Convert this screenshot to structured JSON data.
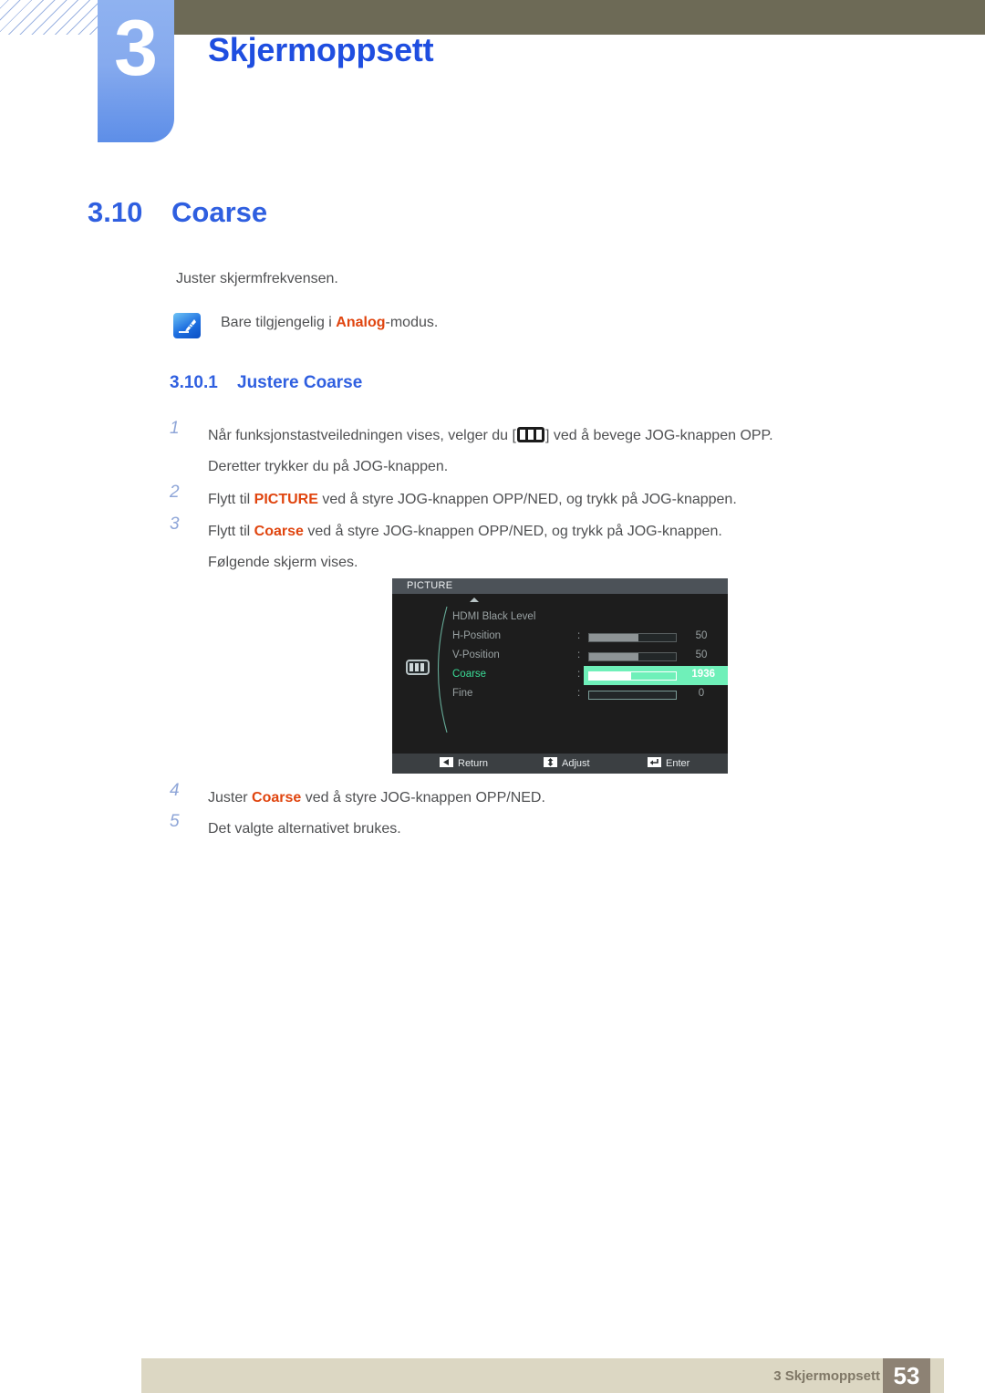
{
  "chapter": {
    "number": "3",
    "title": "Skjermoppsett"
  },
  "section": {
    "number": "3.10",
    "title": "Coarse"
  },
  "intro": "Juster skjermfrekvensen.",
  "note": {
    "icon": "note-pen-icon",
    "prefix": "Bare tilgjengelig i ",
    "highlight": "Analog",
    "suffix": "-modus."
  },
  "subsection": {
    "number": "3.10.1",
    "title": "Justere Coarse"
  },
  "steps": [
    {
      "index": "1",
      "pre": "Når funksjonstastveiledningen vises, velger du [",
      "glyph": "picture-menu-icon",
      "post": "] ved å bevege JOG-knappen OPP.",
      "cont": "Deretter trykker du på JOG-knappen."
    },
    {
      "index": "2",
      "pre": "Flytt til ",
      "highlight": "PICTURE",
      "post": " ved å styre JOG-knappen OPP/NED, og trykk på JOG-knappen."
    },
    {
      "index": "3",
      "pre": "Flytt til ",
      "highlight": "Coarse",
      "post": " ved å styre JOG-knappen OPP/NED, og trykk på JOG-knappen.",
      "cont": "Følgende skjerm vises."
    },
    {
      "index": "4",
      "pre": "Juster ",
      "highlight": "Coarse",
      "post": " ved å styre JOG-knappen OPP/NED."
    },
    {
      "index": "5",
      "pre": "Det valgte alternativet brukes."
    }
  ],
  "osd": {
    "title": "PICTURE",
    "category_icon": "picture-category-icon",
    "scroll_up_icon": "scroll-up-arrow-icon",
    "rows": [
      {
        "label": "HDMI Black Level",
        "colon": "",
        "value": "",
        "fill_pct": null,
        "selected": false
      },
      {
        "label": "H-Position",
        "colon": ":",
        "value": "50",
        "fill_pct": 57,
        "selected": false
      },
      {
        "label": "V-Position",
        "colon": ":",
        "value": "50",
        "fill_pct": 57,
        "selected": false
      },
      {
        "label": "Coarse",
        "colon": ":",
        "value": "1936",
        "fill_pct": 48,
        "selected": true
      },
      {
        "label": "Fine",
        "colon": ":",
        "value": "0",
        "fill_pct": 0,
        "selected": false
      }
    ],
    "footer": [
      {
        "icon": "return-left-arrow-icon",
        "label": "Return"
      },
      {
        "icon": "adjust-updown-arrow-icon",
        "label": "Adjust"
      },
      {
        "icon": "enter-arrow-icon",
        "label": "Enter"
      }
    ]
  },
  "page_footer": {
    "text": "3 Skjermoppsett",
    "page": "53"
  },
  "colors": {
    "accent_blue": "#2f5fe0",
    "highlight_red": "#e0450f",
    "olive": "#6d6a56",
    "footer_tan": "#dcd7c3",
    "page_box": "#8d8274",
    "osd_selected": "#6ff0b9"
  }
}
